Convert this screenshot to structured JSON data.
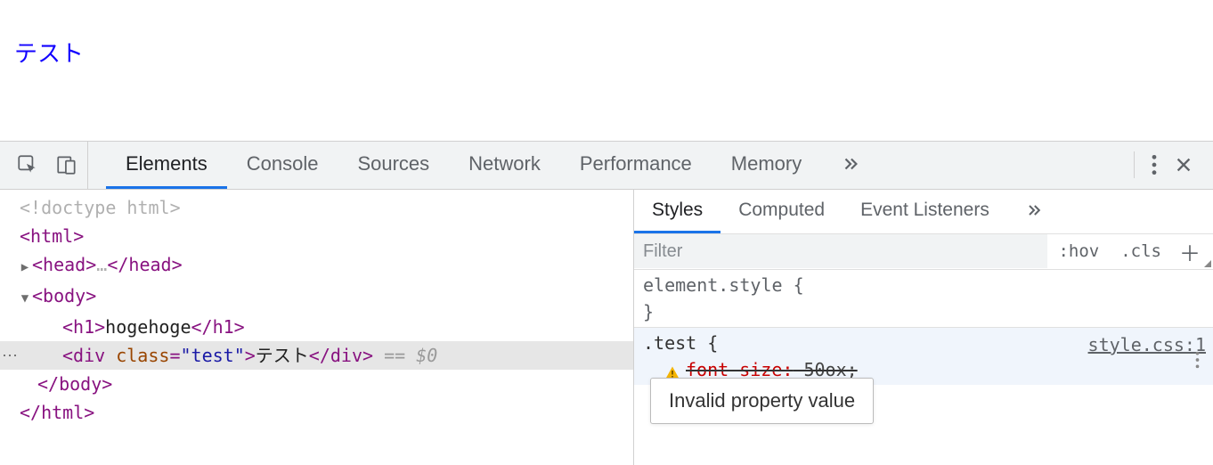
{
  "page": {
    "content_text": "テスト"
  },
  "devtools": {
    "tabs": [
      "Elements",
      "Console",
      "Sources",
      "Network",
      "Performance",
      "Memory"
    ],
    "active_tab": "Elements",
    "styles_tabs": [
      "Styles",
      "Computed",
      "Event Listeners"
    ],
    "active_styles_tab": "Styles",
    "filter_placeholder": "Filter",
    "hov_label": ":hov",
    "cls_label": ".cls"
  },
  "elements": {
    "doctype": "<!doctype html>",
    "html_open": "html",
    "head": "head",
    "head_ellipsis": "…",
    "body_open": "body",
    "h1_text": "hogehoge",
    "div_class_attr": "class",
    "div_class_val": "\"test\"",
    "div_text": "テスト",
    "selected_suffix": " == $0",
    "body_close": "body",
    "html_close": "html"
  },
  "styles": {
    "element_style_label": "element.style {",
    "element_style_close": "}",
    "test_selector": ".test {",
    "source_link": "style.css:1",
    "prop_name": "font-size:",
    "prop_value": " 50ox;",
    "tooltip_text": "Invalid property value"
  }
}
